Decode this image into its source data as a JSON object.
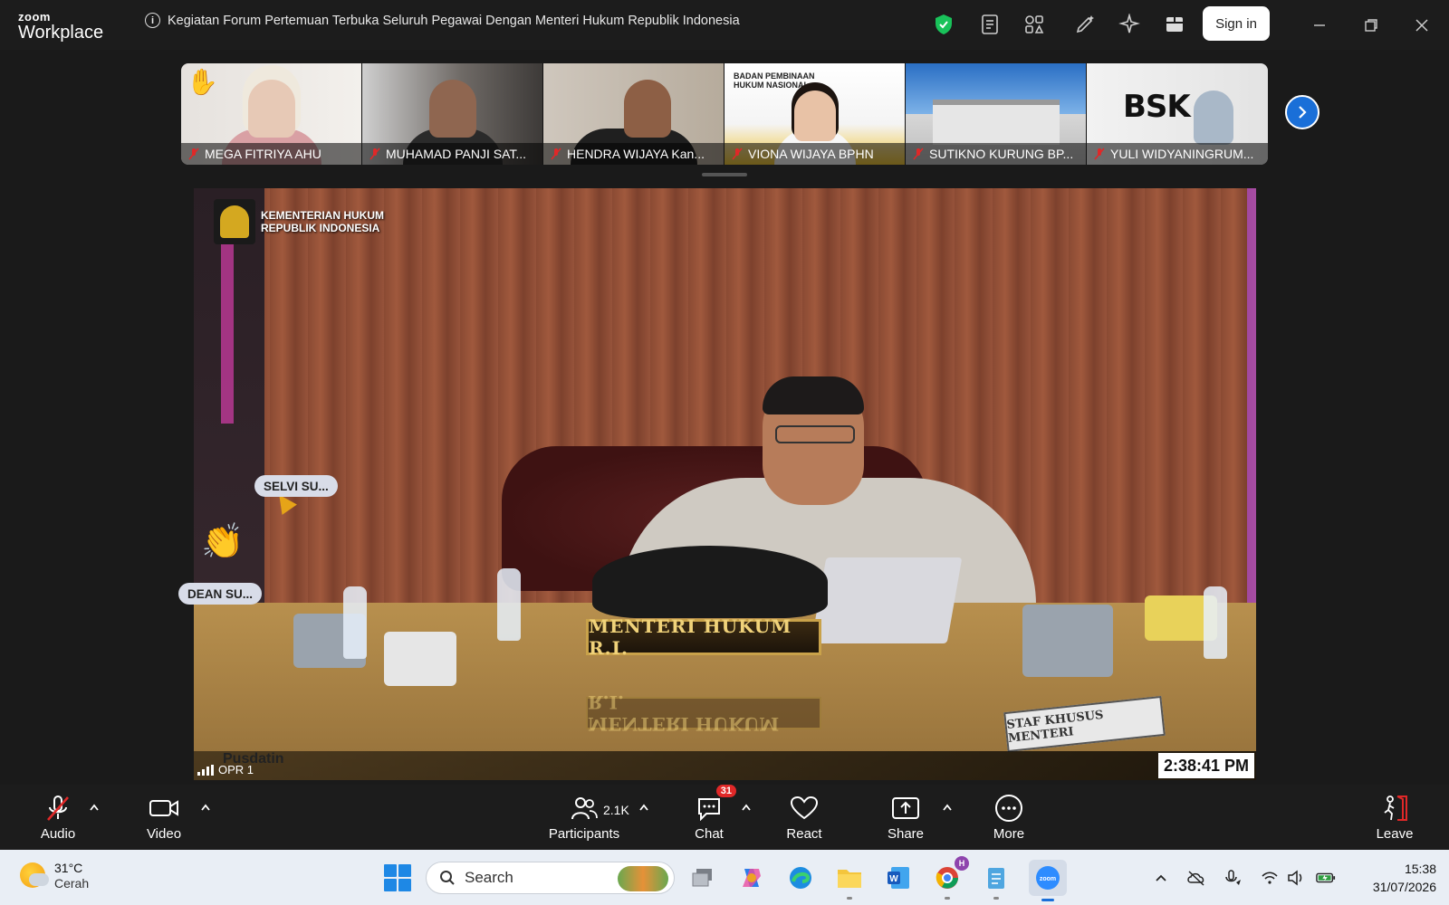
{
  "titlebar": {
    "logo_top": "zoom",
    "logo_bottom": "Workplace",
    "meeting_title": "Kegiatan Forum Pertemuan Terbuka Seluruh Pegawai Dengan Menteri Hukum Republik Indonesia",
    "sign_in_label": "Sign in"
  },
  "gallery": {
    "participants": [
      {
        "name": "MEGA FITRIYA AHU"
      },
      {
        "name": "MUHAMAD PANJI SAT..."
      },
      {
        "name": "HENDRA WIJAYA Kan..."
      },
      {
        "name": "VIONA WIJAYA BPHN"
      },
      {
        "name": "SUTIKNO KURUNG BP..."
      },
      {
        "name": "YULI WIDYANINGRUM..."
      }
    ],
    "tile4_banner_line1": "BADAN PEMBINAAN",
    "tile4_banner_line2": "HUKUM NASIONAL",
    "tile6_logo_text": "BSK"
  },
  "video": {
    "ministry_line1": "KEMENTERIAN HUKUM",
    "ministry_line2": "REPUBLIK INDONESIA",
    "nameplate": "MENTERI HUKUM R.I.",
    "staf_plate": "STAF KHUSUS MENTERI",
    "pusdatin": "Pusdatin",
    "speaker_label": "OPR 1",
    "timestamp": "2:38:41 PM",
    "reactions": [
      {
        "name": "SELVI SU..."
      },
      {
        "name": "DEAN SU..."
      }
    ]
  },
  "toolbar": {
    "audio_label": "Audio",
    "video_label": "Video",
    "participants_label": "Participants",
    "participants_count": "2.1K",
    "chat_label": "Chat",
    "chat_badge": "31",
    "react_label": "React",
    "share_label": "Share",
    "more_label": "More",
    "leave_label": "Leave"
  },
  "taskbar": {
    "temperature": "31°C",
    "condition": "Cerah",
    "search_placeholder": "Search",
    "time": "15:38",
    "date": "31/07/2026",
    "chrome_badge": "H"
  },
  "colors": {
    "accent_blue": "#1a6fd8",
    "mute_red": "#e02828",
    "shield_green": "#19c25a"
  }
}
